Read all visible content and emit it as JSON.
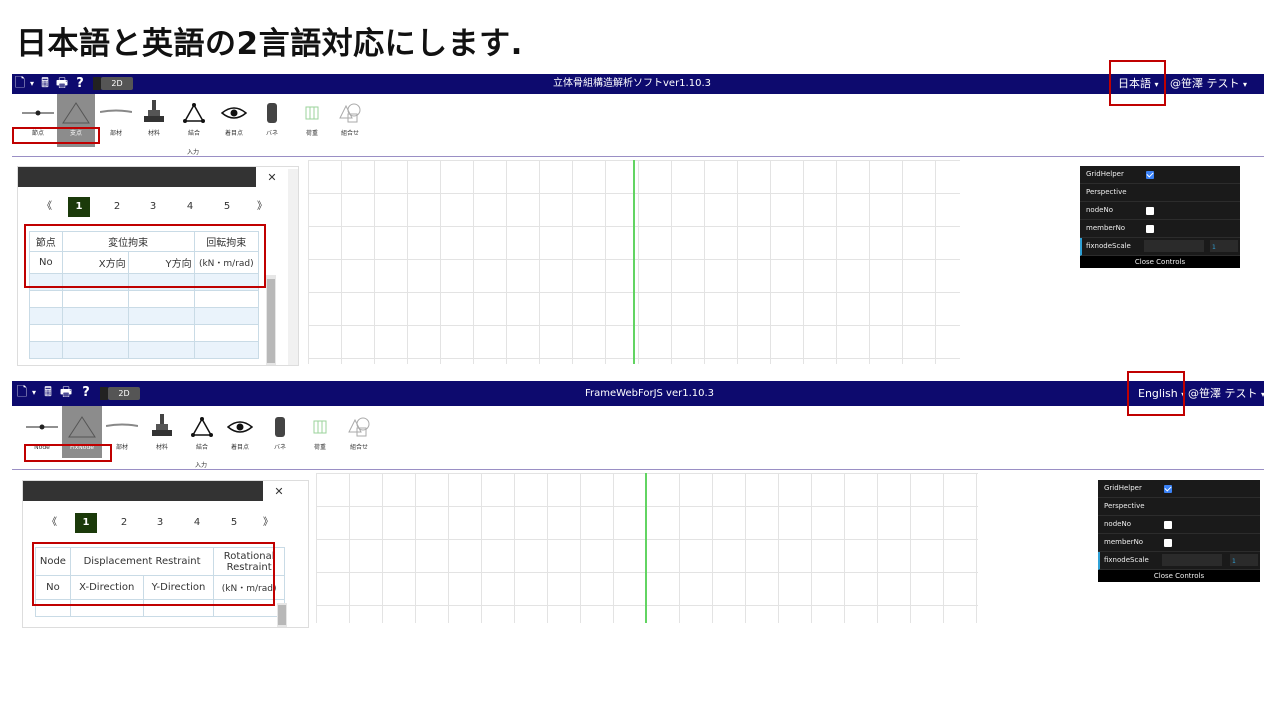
{
  "slide_title": "日本語と英語の2言語対応にします.",
  "top": {
    "mode_label": "2D",
    "app_title": "立体骨組構造解析ソフトver1.10.3",
    "language": "日本語",
    "user": "@笹澤 テスト",
    "ribbon": [
      "節点",
      "支点",
      "部材",
      "材料",
      "結合",
      "着目点",
      "バネ",
      "荷重",
      "組合せ"
    ],
    "input_label": "入力",
    "pages": [
      "《",
      "1",
      "2",
      "3",
      "4",
      "5",
      "》"
    ],
    "table": {
      "h_node": "節点",
      "h_disp": "変位拘束",
      "h_rot": "回転拘束",
      "s_no": "No",
      "s_x": "X方向",
      "s_y": "Y方向",
      "s_unit": "(kN・m/rad)"
    }
  },
  "bottom": {
    "mode_label": "2D",
    "app_title": "FrameWebForJS ver1.10.3",
    "language": "English",
    "user": "@笹澤 テスト",
    "ribbon": [
      "Node",
      "FixNode",
      "部材",
      "材料",
      "結合",
      "着目点",
      "バネ",
      "荷重",
      "組合せ"
    ],
    "input_label": "入力",
    "pages": [
      "《",
      "1",
      "2",
      "3",
      "4",
      "5",
      "》"
    ],
    "table": {
      "h_node": "Node",
      "h_disp": "Displacement Restraint",
      "h_rot": "Rotational Restraint",
      "s_no": "No",
      "s_x": "X-Direction",
      "s_y": "Y-Direction",
      "s_unit": "(kN・m/rad)"
    }
  },
  "controls": {
    "grid_helper": "GridHelper",
    "perspective": "Perspective",
    "node_no": "nodeNo",
    "member_no": "memberNo",
    "fix_scale": "fixnodeScale",
    "scale_value": "1",
    "close": "Close Controls"
  },
  "colors": {
    "topbar": "#0d0a6e",
    "highlight": "#c00000",
    "axis_line": "#62d462"
  }
}
